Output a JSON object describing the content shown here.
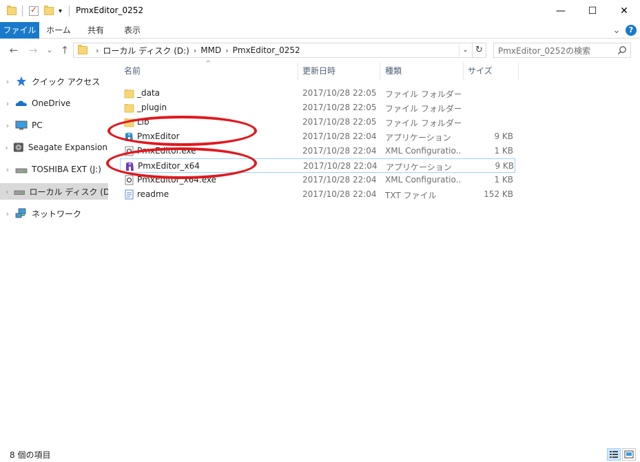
{
  "window": {
    "title": "PmxEditor_0252",
    "min_glyph": "—",
    "max_glyph": "☐",
    "close_glyph": "✕"
  },
  "ribbon": {
    "tabs": [
      "ファイル",
      "ホーム",
      "共有",
      "表示"
    ],
    "expand_glyph": "⌄",
    "help_glyph": "?"
  },
  "nav": {
    "back_glyph": "←",
    "forward_glyph": "→",
    "recent_glyph": "⌄",
    "up_glyph": "↑",
    "breadcrumb": [
      "ローカル ディスク (D:)",
      "MMD",
      "PmxEditor_0252"
    ],
    "crumb_sep": "›",
    "dropdown_glyph": "⌄",
    "refresh_glyph": "↻",
    "search_placeholder": "PmxEditor_0252の検索"
  },
  "sidebar": {
    "items": [
      {
        "label": "クイック アクセス",
        "icon": "star-icon"
      },
      {
        "label": "OneDrive",
        "icon": "cloud-icon"
      },
      {
        "label": "PC",
        "icon": "monitor-icon"
      },
      {
        "label": "Seagate Expansion Dr",
        "icon": "disc-icon"
      },
      {
        "label": "TOSHIBA EXT (J:)",
        "icon": "drive-icon"
      },
      {
        "label": "ローカル ディスク (D:)",
        "icon": "drive-icon",
        "selected": true
      },
      {
        "label": "ネットワーク",
        "icon": "network-icon"
      }
    ],
    "chevron": "›"
  },
  "columns": {
    "name": "名前",
    "date": "更新日時",
    "type": "種類",
    "size": "サイズ",
    "sort_glyph": "^"
  },
  "files": [
    {
      "name": "_data",
      "date": "2017/10/28 22:05",
      "type": "ファイル フォルダー",
      "size": "",
      "icon": "folder-icon"
    },
    {
      "name": "_plugin",
      "date": "2017/10/28 22:05",
      "type": "ファイル フォルダー",
      "size": "",
      "icon": "folder-icon"
    },
    {
      "name": "Lib",
      "date": "2017/10/28 22:05",
      "type": "ファイル フォルダー",
      "size": "",
      "icon": "folder-icon"
    },
    {
      "name": "PmxEditor",
      "date": "2017/10/28 22:04",
      "type": "アプリケーション",
      "size": "9 KB",
      "icon": "app-icon"
    },
    {
      "name": "PmxEditor.exe",
      "date": "2017/10/28 22:04",
      "type": "XML Configuratio...",
      "size": "1 KB",
      "icon": "config-icon"
    },
    {
      "name": "PmxEditor_x64",
      "date": "2017/10/28 22:04",
      "type": "アプリケーション",
      "size": "9 KB",
      "icon": "app64-icon",
      "selected": true
    },
    {
      "name": "PmxEditor_x64.exe",
      "date": "2017/10/28 22:04",
      "type": "XML Configuratio...",
      "size": "1 KB",
      "icon": "config-icon"
    },
    {
      "name": "readme",
      "date": "2017/10/28 22:04",
      "type": "TXT ファイル",
      "size": "152 KB",
      "icon": "text-file-icon"
    }
  ],
  "status": {
    "item_count": "8 個の項目"
  },
  "colors": {
    "accent": "#1979ca",
    "annotation": "#e0191e",
    "folder": "#f7d775"
  }
}
